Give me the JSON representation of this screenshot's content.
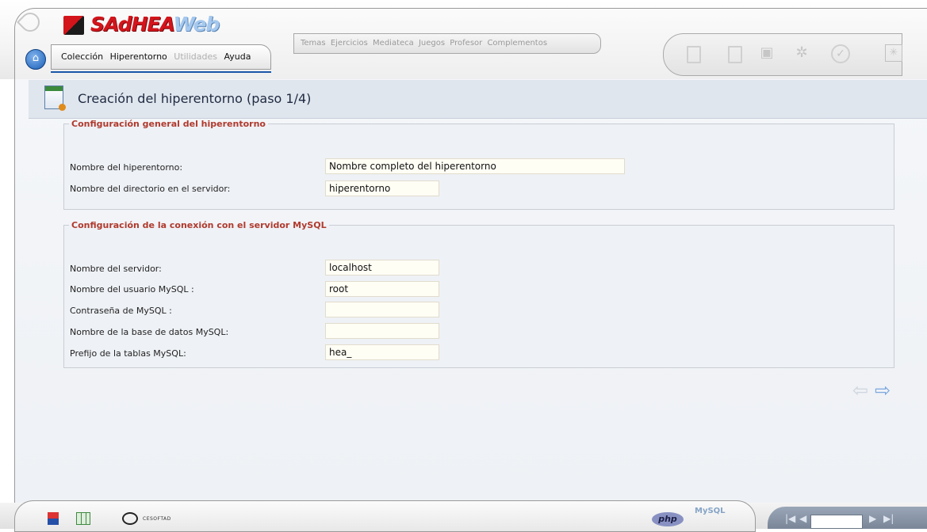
{
  "app": {
    "logo_main": "SAdHEA",
    "logo_web": "Web"
  },
  "menu": {
    "items": [
      {
        "label": "Colección",
        "enabled": true
      },
      {
        "label": "Hiperentorno",
        "enabled": true
      },
      {
        "label": "Utilidades",
        "enabled": false
      },
      {
        "label": "Ayuda",
        "enabled": true
      }
    ]
  },
  "sections": {
    "items": [
      "Temas",
      "Ejercicios",
      "Mediateca",
      "Juegos",
      "Profesor",
      "Complementos"
    ]
  },
  "toolbar": {
    "icons": [
      "new-document-icon",
      "open-document-icon",
      "save-icon",
      "settings-icon",
      "accept-icon",
      "star-icon"
    ]
  },
  "page": {
    "title": "Creación del hiperentorno (paso 1/4)"
  },
  "general": {
    "legend": "Configuración general del hiperentorno",
    "name_label": "Nombre del hiperentorno:",
    "name_value": "Nombre completo del hiperentorno",
    "dir_label": "Nombre del directorio en el servidor:",
    "dir_value": "hiperentorno"
  },
  "mysql": {
    "legend": "Configuración de la conexión con el servidor MySQL",
    "server_label": "Nombre del servidor:",
    "server_value": "localhost",
    "user_label": "Nombre del usuario MySQL :",
    "user_value": "root",
    "password_label": "Contraseña de MySQL :",
    "password_value": "",
    "db_label": "Nombre de la base de datos MySQL:",
    "db_value": "",
    "prefix_label": "Prefijo de la tablas MySQL:",
    "prefix_value": "hea_"
  },
  "footer": {
    "cesoft_text": "CESOFTAD",
    "php_text": "php",
    "mysql_text": "MySQL"
  },
  "colors": {
    "legend": "#b03a2e",
    "accent": "#1a56a8",
    "brand_red": "#d3141b"
  }
}
